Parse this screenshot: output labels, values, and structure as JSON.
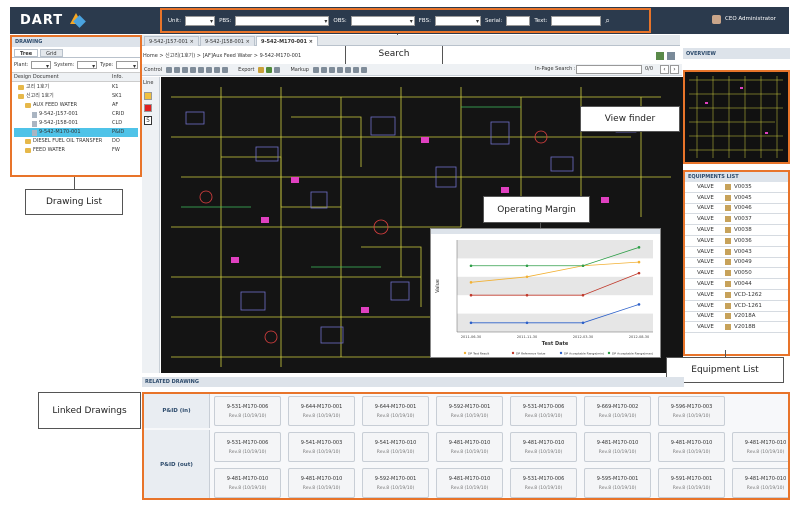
{
  "app": {
    "logo": "DART",
    "user": "CEO Administrator"
  },
  "search": {
    "unit_label": "Unit:",
    "pbs_label": "PBS:",
    "obs_label": "OBS:",
    "fbs_label": "FBS:",
    "serial_label": "Serial:",
    "text_label": "Text:"
  },
  "tabs": [
    "9-542-J157-001 ×",
    "9-542-J158-001 ×",
    "9-542-M170-001 ×"
  ],
  "breadcrumb": "Home > 신고리(1호기) > [AF]Aux Feed Water > 9-542-M170-001",
  "toolbar": {
    "control": "Control",
    "export": "Export",
    "markup": "Markup",
    "inpage_label": "In-Page Search :",
    "page_count": "0/0",
    "line_label": "Line"
  },
  "drawing_panel": {
    "title": "DRAWING",
    "tabs": [
      "Tree",
      "Grid"
    ],
    "filters": {
      "plant": "Plant:",
      "system": "System:",
      "type": "Type:"
    },
    "columns": [
      "Design Document",
      "Info."
    ],
    "tree": [
      {
        "label": "고리 1호기",
        "info": "K1",
        "depth": 0,
        "kind": "folder"
      },
      {
        "label": "신고리 1호기",
        "info": "SK1",
        "depth": 0,
        "kind": "folder"
      },
      {
        "label": "AUX FEED WATER",
        "info": "AF",
        "depth": 1,
        "kind": "folder"
      },
      {
        "label": "9-542-J157-001",
        "info": "CRID",
        "depth": 2,
        "kind": "file"
      },
      {
        "label": "9-542-J158-001",
        "info": "CLD",
        "depth": 2,
        "kind": "file"
      },
      {
        "label": "9-542-M170-001",
        "info": "P&ID",
        "depth": 2,
        "kind": "file",
        "selected": true
      },
      {
        "label": "DIESEL FUEL OIL TRANSFER",
        "info": "DO",
        "depth": 1,
        "kind": "folder"
      },
      {
        "label": "FEED WATER",
        "info": "FW",
        "depth": 1,
        "kind": "folder"
      }
    ]
  },
  "overview": {
    "title": "OVERVIEW"
  },
  "equipments": {
    "title": "EQUIPMENTS LIST",
    "rows": [
      {
        "type": "VALVE",
        "id": "V0035"
      },
      {
        "type": "VALVE",
        "id": "V0045"
      },
      {
        "type": "VALVE",
        "id": "V0046"
      },
      {
        "type": "VALVE",
        "id": "V0037"
      },
      {
        "type": "VALVE",
        "id": "V0038"
      },
      {
        "type": "VALVE",
        "id": "V0036"
      },
      {
        "type": "VALVE",
        "id": "V0043"
      },
      {
        "type": "VALVE",
        "id": "V0049"
      },
      {
        "type": "VALVE",
        "id": "V0050"
      },
      {
        "type": "VALVE",
        "id": "V0044"
      },
      {
        "type": "VALVE",
        "id": "VCD-1262"
      },
      {
        "type": "VALVE",
        "id": "VCD-1261"
      },
      {
        "type": "VALVE",
        "id": "V2018A"
      },
      {
        "type": "VALVE",
        "id": "V2018B"
      }
    ]
  },
  "related": {
    "title": "RELATED DRAWING",
    "in_label": "P&ID (in)",
    "out_label": "P&ID (out)",
    "in_cards": [
      {
        "id": "9-531-M170-006",
        "rev": "Rev.8 (10/19/10)"
      },
      {
        "id": "9-644-M170-001",
        "rev": "Rev.8 (10/19/10)"
      },
      {
        "id": "9-644-M170-001",
        "rev": "Rev.8 (10/19/10)"
      },
      {
        "id": "9-592-M170-001",
        "rev": "Rev.8 (10/19/10)"
      },
      {
        "id": "9-531-M170-006",
        "rev": "Rev.8 (10/19/10)"
      },
      {
        "id": "9-669-M170-002",
        "rev": "Rev.8 (10/19/10)"
      },
      {
        "id": "9-596-M170-003",
        "rev": "Rev.8 (10/19/10)"
      }
    ],
    "out_cards_row1": [
      {
        "id": "9-531-M170-006",
        "rev": "Rev.8 (10/19/10)"
      },
      {
        "id": "9-541-M170-003",
        "rev": "Rev.8 (10/19/10)"
      },
      {
        "id": "9-541-M170-010",
        "rev": "Rev.8 (10/19/10)"
      },
      {
        "id": "9-481-M170-010",
        "rev": "Rev.8 (10/19/10)"
      },
      {
        "id": "9-481-M170-010",
        "rev": "Rev.8 (10/19/10)"
      },
      {
        "id": "9-481-M170-010",
        "rev": "Rev.8 (10/19/10)"
      },
      {
        "id": "9-481-M170-010",
        "rev": "Rev.8 (10/19/10)"
      },
      {
        "id": "9-481-M170-010",
        "rev": "Rev.8 (10/19/10)"
      }
    ],
    "out_cards_row2": [
      {
        "id": "9-481-M170-010",
        "rev": "Rev.8 (10/19/10)"
      },
      {
        "id": "9-481-M170-010",
        "rev": "Rev.8 (10/19/10)"
      },
      {
        "id": "9-592-M170-001",
        "rev": "Rev.8 (10/19/10)"
      },
      {
        "id": "9-481-M170-010",
        "rev": "Rev.8 (10/19/10)"
      },
      {
        "id": "9-531-M170-006",
        "rev": "Rev.8 (10/19/10)"
      },
      {
        "id": "9-595-M170-001",
        "rev": "Rev.8 (10/19/10)"
      },
      {
        "id": "9-591-M170-001",
        "rev": "Rev.8 (10/19/10)"
      },
      {
        "id": "9-481-M170-010",
        "rev": "Rev.8 (10/19/10)"
      }
    ]
  },
  "callouts": {
    "search": "Search",
    "view_finder": "View finder",
    "drawing_list": "Drawing List",
    "operating_margin": "Operating Margin",
    "equipment_list": "Equipment List",
    "linked_drawings": "Linked Drawings"
  },
  "chart_data": {
    "type": "line",
    "x": [
      "2011-06-30",
      "2011-11-30",
      "2012-03-30",
      "2012-08-30"
    ],
    "xlabel": "Test Date",
    "ylabel": "Value",
    "series": [
      {
        "name": "DP Test Result",
        "color": "#f2b134",
        "values": [
          47,
          50,
          56,
          58
        ]
      },
      {
        "name": "DP Reference Value",
        "color": "#c0392b",
        "values": [
          40,
          40,
          40,
          52
        ]
      },
      {
        "name": "DP Acceptable Range(min)",
        "color": "#2b5fc9",
        "values": [
          25,
          25,
          25,
          35
        ]
      },
      {
        "name": "DP Acceptable Range(max)",
        "color": "#2e9e48",
        "values": [
          56,
          56,
          56,
          66
        ]
      }
    ],
    "ylim": [
      20,
      70
    ],
    "legend": "bottom"
  }
}
